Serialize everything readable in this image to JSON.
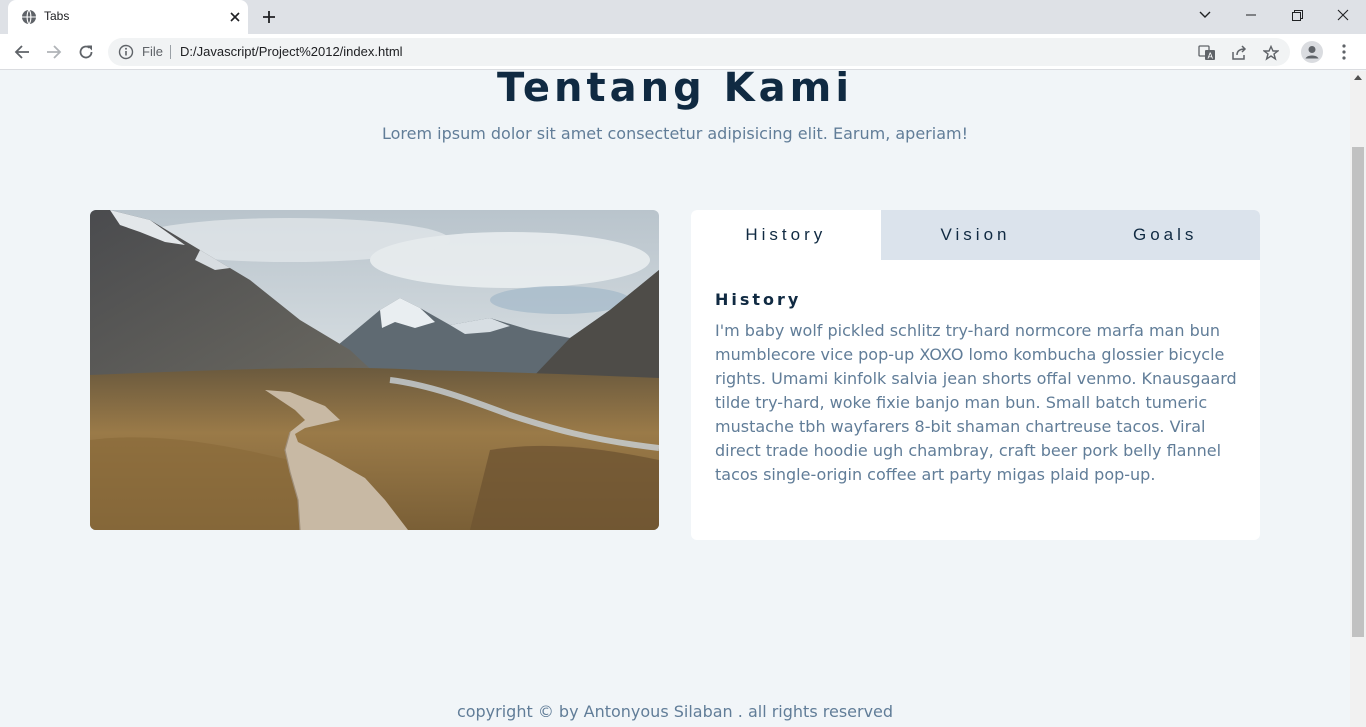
{
  "browser": {
    "tab_title": "Tabs",
    "file_label": "File",
    "url": "D:/Javascript/Project%2012/index.html"
  },
  "page": {
    "title": "Tentang Kami",
    "subtitle": "Lorem ipsum dolor sit amet consectetur adipisicing elit. Earum, aperiam!",
    "tabs": [
      {
        "label": "History",
        "active": true
      },
      {
        "label": "Vision",
        "active": false
      },
      {
        "label": "Goals",
        "active": false
      }
    ],
    "content": {
      "title": "History",
      "text": "I'm baby wolf pickled schlitz try-hard normcore marfa man bun mumblecore vice pop-up XOXO lomo kombucha glossier bicycle rights. Umami kinfolk salvia jean shorts offal venmo. Knausgaard tilde try-hard, woke fixie banjo man bun. Small batch tumeric mustache tbh wayfarers 8-bit shaman chartreuse tacos. Viral direct trade hoodie ugh chambray, craft beer pork belly flannel tacos single-origin coffee art party migas plaid pop-up."
    },
    "footer": "copyright © by Antonyous Silaban . all rights reserved"
  },
  "colors": {
    "heading": "#102a42",
    "text": "#617d98",
    "page_bg": "#f1f5f8",
    "tab_inactive_bg": "#dbe3ec"
  }
}
